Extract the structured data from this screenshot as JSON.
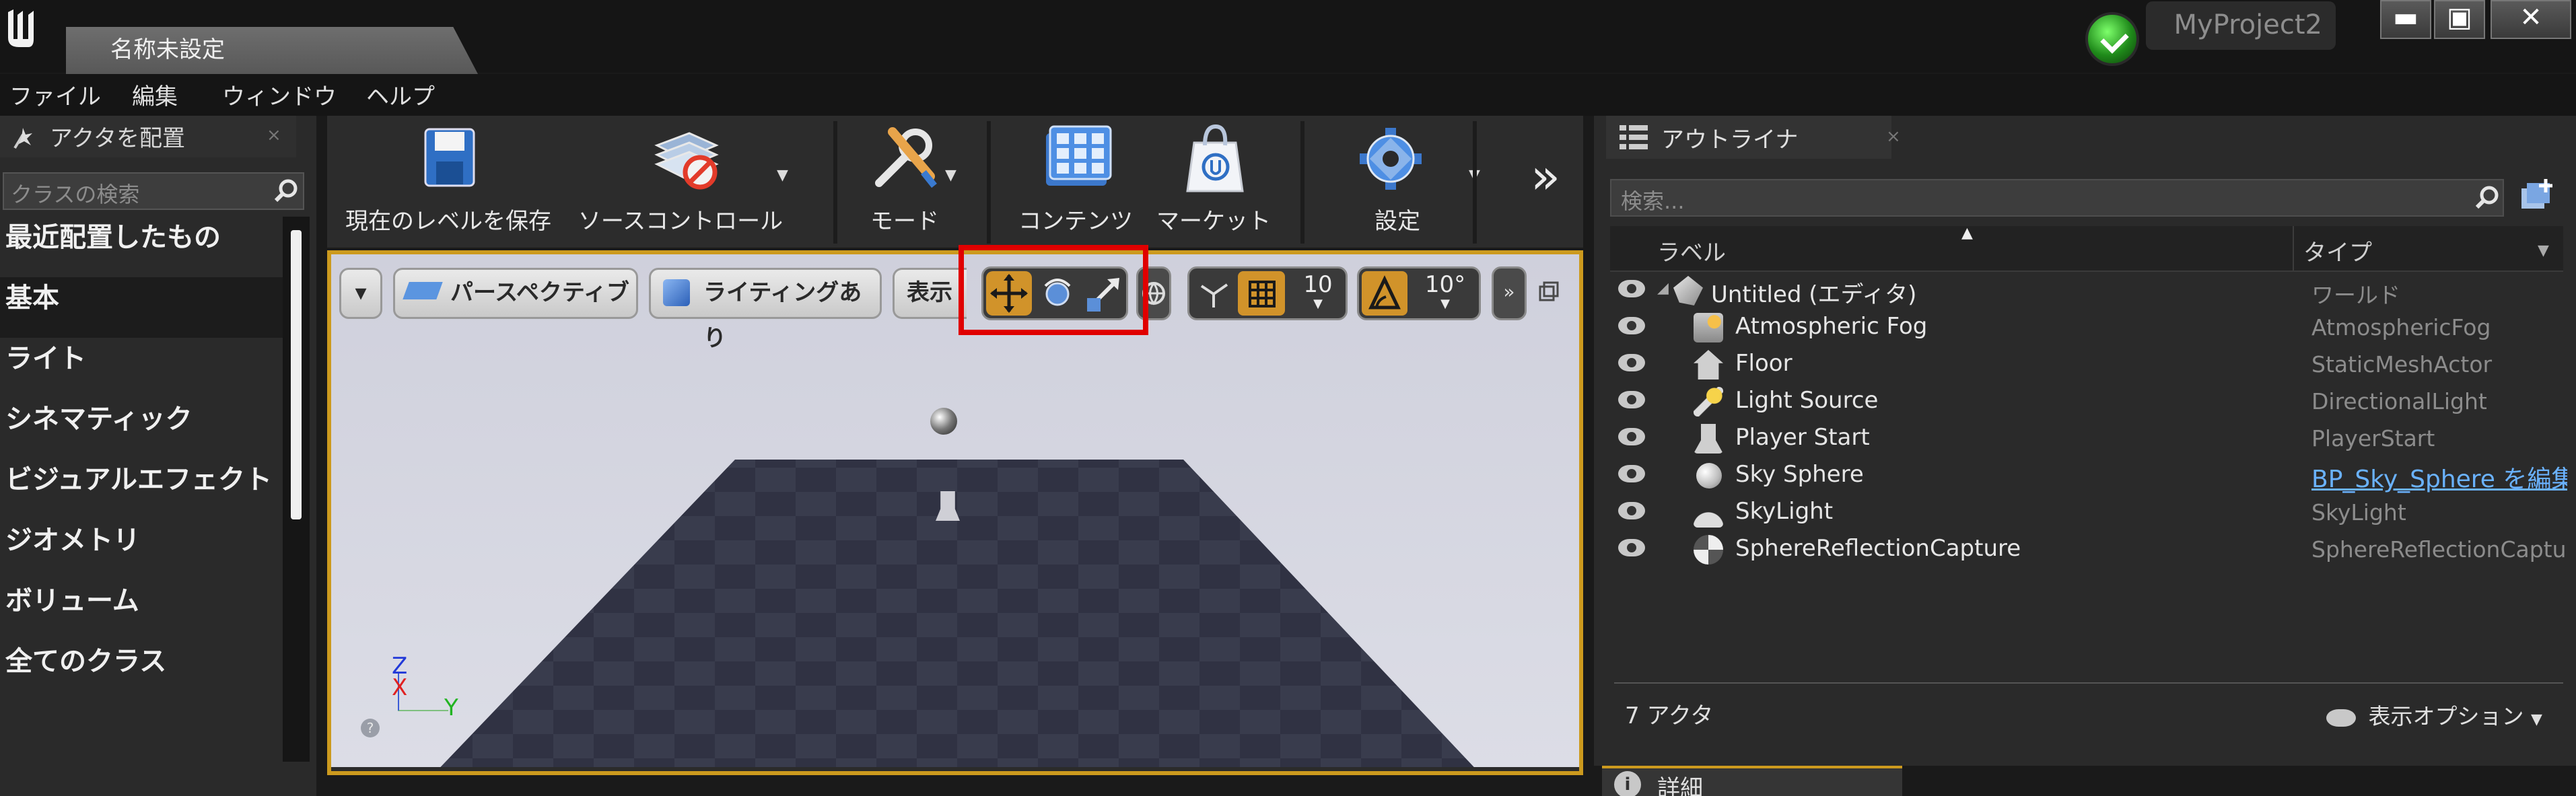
{
  "window": {
    "doc_tab": "名称未設定",
    "project": "MyProject2",
    "controls": [
      "▬",
      "▣",
      "✕"
    ]
  },
  "menu": [
    "ファイル",
    "編集",
    "ウィンドウ",
    "ヘルプ"
  ],
  "place_actors": {
    "tab_label": "アクタを配置",
    "search_placeholder": "クラスの検索",
    "categories": [
      "最近配置したもの",
      "基本",
      "ライト",
      "シネマティック",
      "ビジュアルエフェクト",
      "ジオメトリ",
      "ボリューム",
      "全てのクラス"
    ],
    "active_category": "基本"
  },
  "toolbar": {
    "items": [
      {
        "label": "現在のレベルを保存",
        "icon": "save-icon"
      },
      {
        "label": "ソースコントロール",
        "icon": "source-control-icon"
      },
      {
        "label": "モード",
        "icon": "modes-icon"
      },
      {
        "label": "コンテンツ",
        "icon": "content-browser-icon"
      },
      {
        "label": "マーケット",
        "icon": "marketplace-icon"
      },
      {
        "label": "設定",
        "icon": "settings-icon"
      }
    ],
    "overflow": "»"
  },
  "viewport": {
    "view_mode": "パースペクティブ",
    "lighting": "ライティングあり",
    "show": "表示",
    "grid_snap": "10",
    "rotation_snap": "10°",
    "axis": {
      "z": "Z",
      "x": "X",
      "y": "Y"
    }
  },
  "outliner": {
    "tab_label": "アウトライナ",
    "search_placeholder": "検索...",
    "columns": {
      "label": "ラベル",
      "type": "タイプ"
    },
    "rows": [
      {
        "label": "Untitled (エディタ)",
        "type": "ワールド",
        "icon": "world-icon",
        "root": true
      },
      {
        "label": "Atmospheric Fog",
        "type": "AtmosphericFog",
        "icon": "atmospheric-fog-icon"
      },
      {
        "label": "Floor",
        "type": "StaticMeshActor",
        "icon": "static-mesh-icon"
      },
      {
        "label": "Light Source",
        "type": "DirectionalLight",
        "icon": "directional-light-icon"
      },
      {
        "label": "Player Start",
        "type": "PlayerStart",
        "icon": "player-start-icon"
      },
      {
        "label": "Sky Sphere",
        "type": "BP_Sky_Sphere を編集",
        "icon": "sky-sphere-icon",
        "link": true
      },
      {
        "label": "SkyLight",
        "type": "SkyLight",
        "icon": "skylight-icon"
      },
      {
        "label": "SphereReflectionCapture",
        "type": "SphereReflectionCapture",
        "icon": "reflection-capture-icon"
      }
    ],
    "actor_count": "7 アクタ",
    "view_options": "表示オプション"
  },
  "details": {
    "tab_label": "詳細"
  },
  "colors": {
    "accent": "#cc9a1e",
    "highlight": "#e00000",
    "link": "#6ab2ff"
  }
}
